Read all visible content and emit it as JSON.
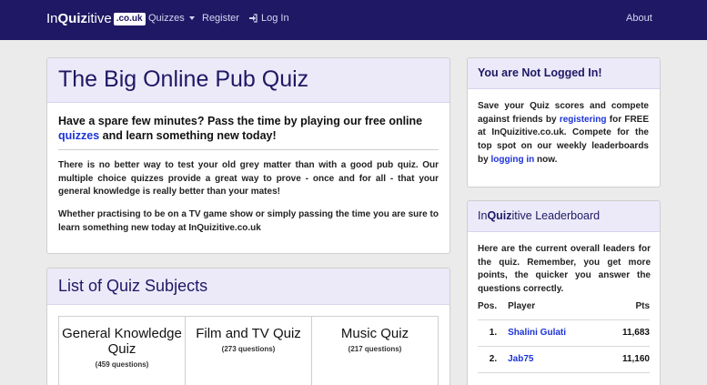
{
  "nav": {
    "brand_pre": "In",
    "brand_bold": "Quiz",
    "brand_post": "itive",
    "brand_domain": ".co.uk",
    "quizzes": "Quizzes",
    "register": "Register",
    "login": "Log In",
    "about": "About"
  },
  "main": {
    "title": "The Big Online Pub Quiz",
    "lead_pre": "Have a spare few minutes? Pass the time by playing our free online",
    "lead_link": "quizzes",
    "lead_post": "and learn something new today!",
    "para1": "There is no better way to test your old grey matter than with a good pub quiz. Our multiple choice quizzes provide a great way to prove - once and for all - that your general knowledge is really better than your mates!",
    "para2": "Whether practising to be on a TV game show or simply passing the time you are sure to learn something new today at InQuizitive.co.uk"
  },
  "subjects": {
    "title": "List of Quiz Subjects",
    "cards": [
      {
        "title": "General Knowledge Quiz",
        "count": "(459 questions)"
      },
      {
        "title": "Film and TV Quiz",
        "count": "(273 questions)"
      },
      {
        "title": "Music Quiz",
        "count": "(217 questions)"
      }
    ]
  },
  "login_panel": {
    "title": "You are Not Logged In!",
    "text1": "Save your Quiz scores and compete against friends by",
    "link1": "registering",
    "text2": "for FREE at InQuizitive.co.uk. Compete for the top spot on our weekly leaderboards by",
    "link2": "logging in",
    "text3": "now."
  },
  "leaderboard": {
    "title_pre": "In",
    "title_bold": "Quiz",
    "title_post": "itive Leaderboard",
    "intro": "Here are the current overall leaders for the quiz. Remember, you get more points, the quicker you answer the questions correctly.",
    "col_pos": "Pos.",
    "col_player": "Player",
    "col_pts": "Pts",
    "rows": [
      {
        "pos": "1.",
        "player": "Shalini Gulati",
        "pts": "11,683"
      },
      {
        "pos": "2.",
        "player": "Jab75",
        "pts": "11,160"
      }
    ]
  }
}
